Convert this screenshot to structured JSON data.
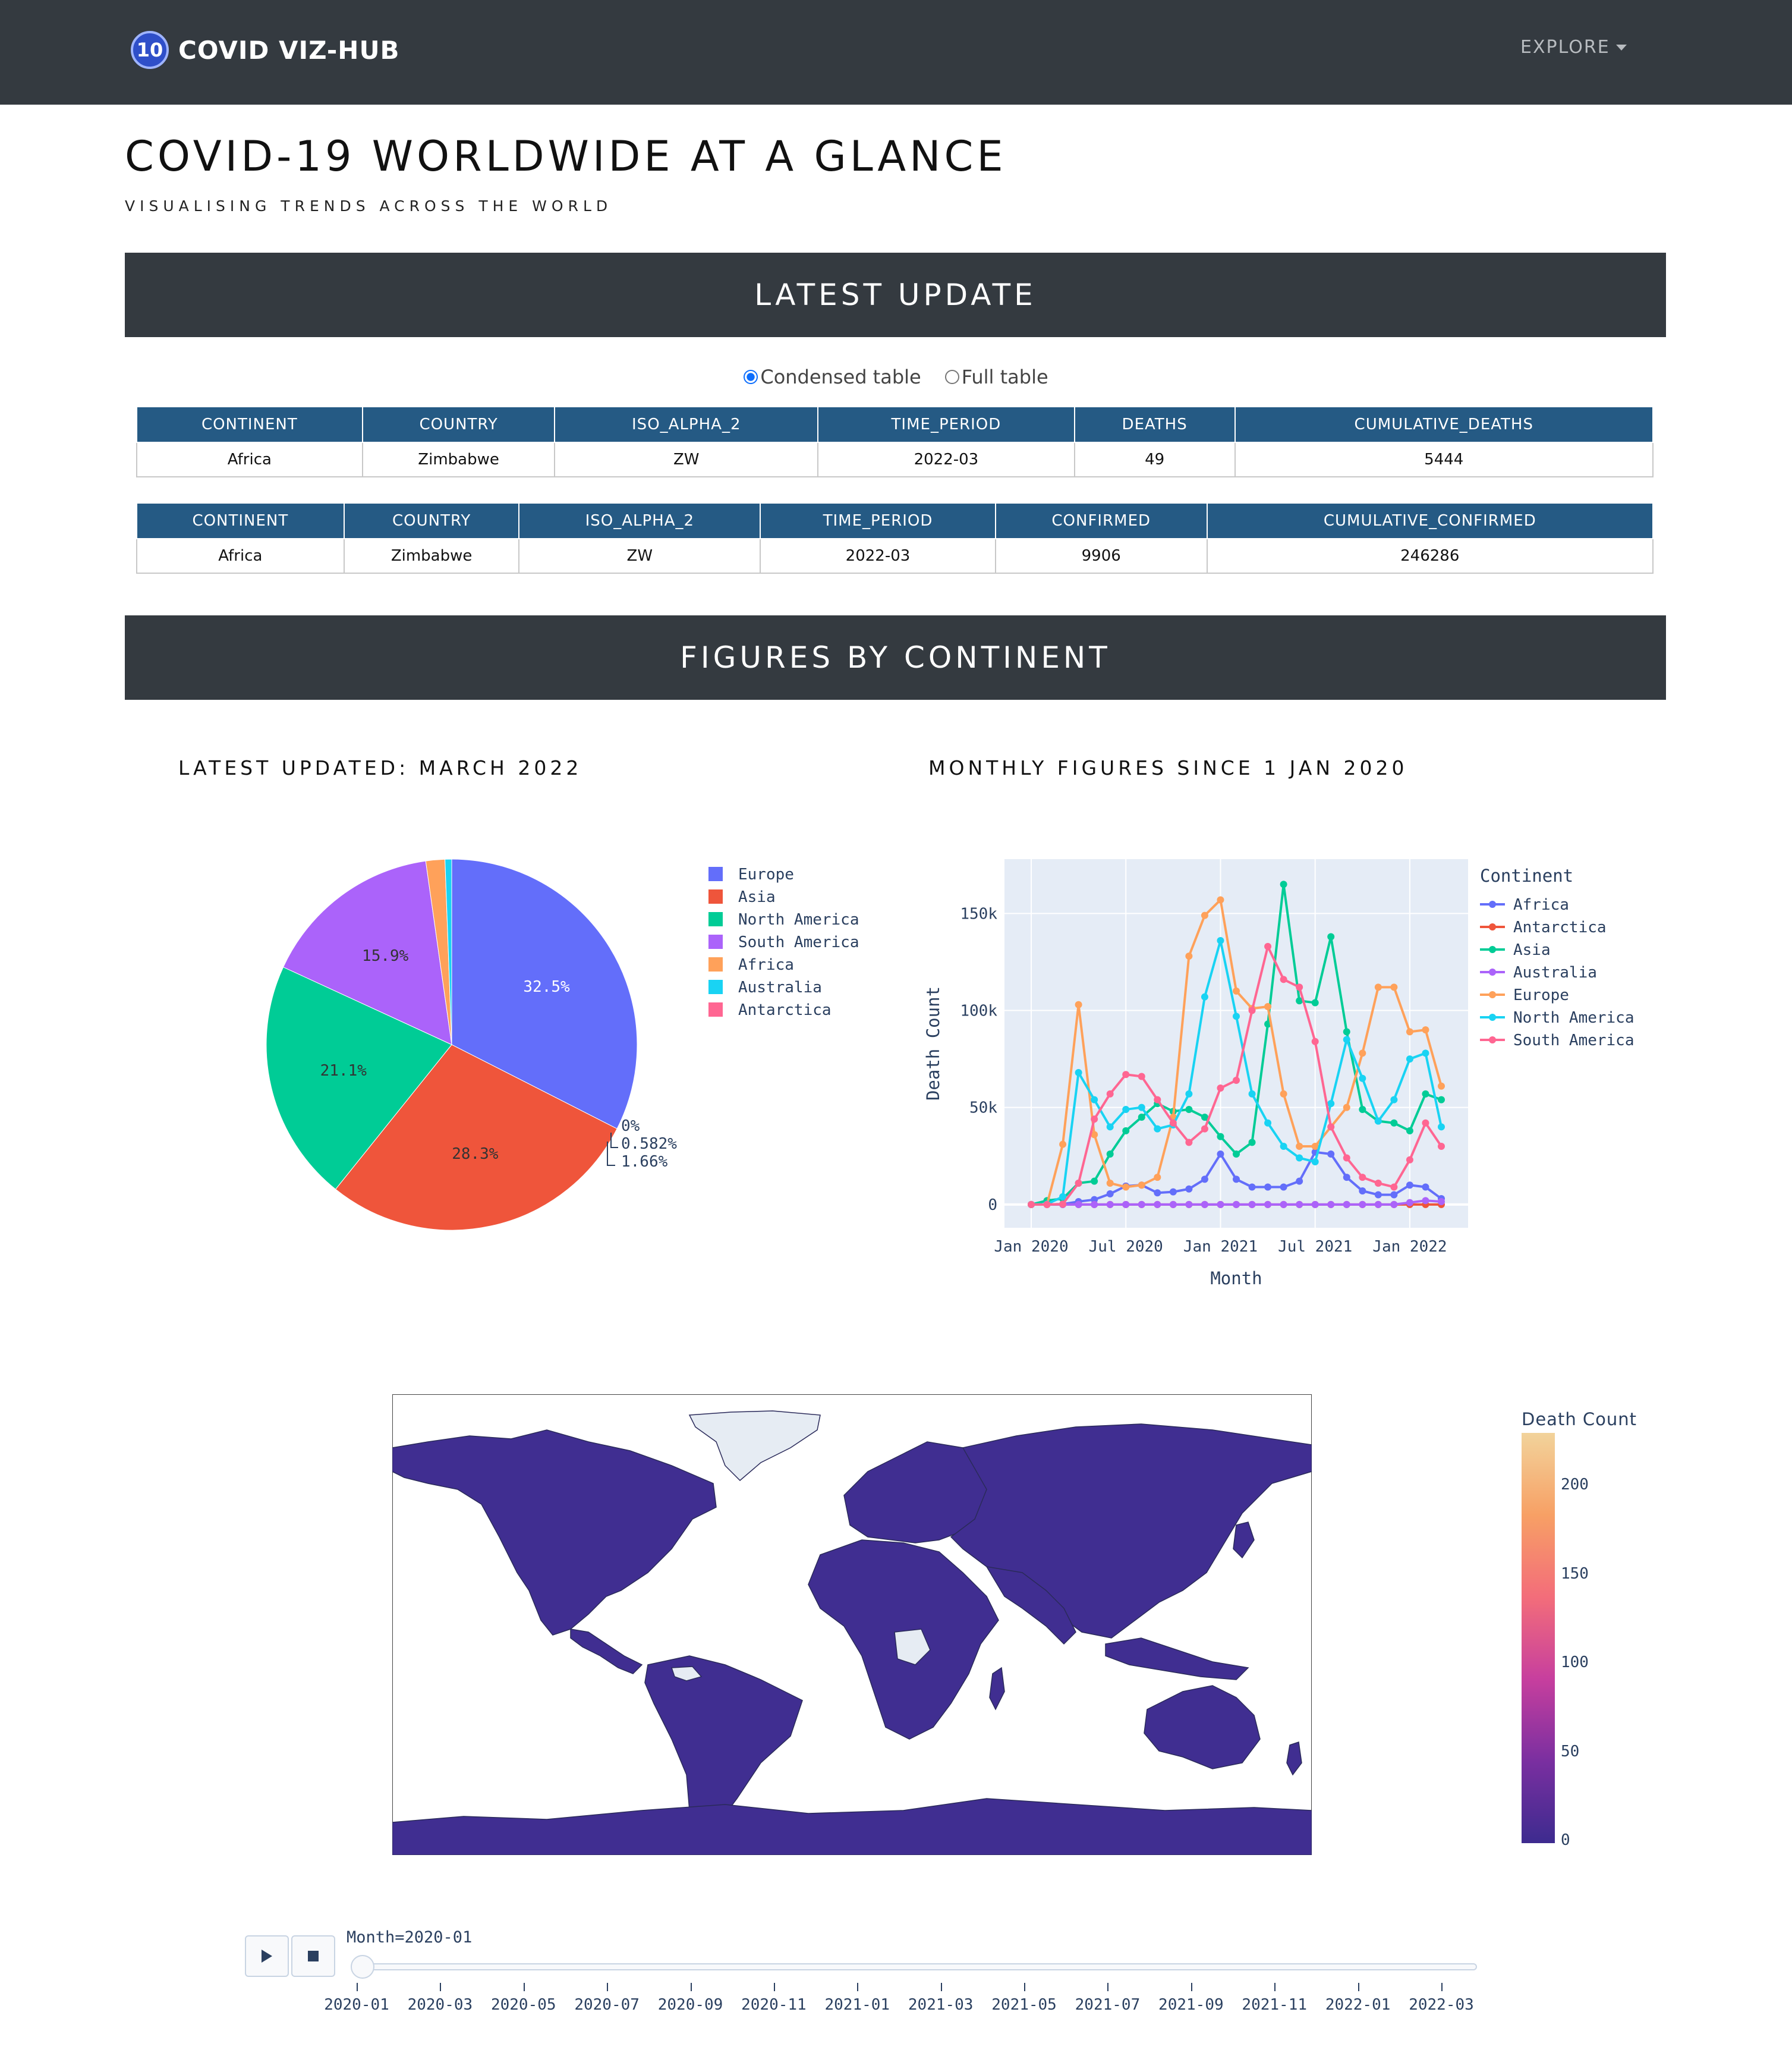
{
  "navbar": {
    "logo_text": "10",
    "brand": "COVID VIZ-HUB",
    "explore": "EXPLORE"
  },
  "header": {
    "title": "COVID-19 WORLDWIDE AT A GLANCE",
    "subtitle": "VISUALISING TRENDS ACROSS THE WORLD"
  },
  "latest_update": {
    "banner": "LATEST UPDATE",
    "radio_condensed": "Condensed table",
    "radio_full": "Full table",
    "deaths_table": {
      "headers": [
        "CONTINENT",
        "COUNTRY",
        "ISO_ALPHA_2",
        "TIME_PERIOD",
        "DEATHS",
        "CUMULATIVE_DEATHS"
      ],
      "row": [
        "Africa",
        "Zimbabwe",
        "ZW",
        "2022-03",
        "49",
        "5444"
      ]
    },
    "confirmed_table": {
      "headers": [
        "CONTINENT",
        "COUNTRY",
        "ISO_ALPHA_2",
        "TIME_PERIOD",
        "CONFIRMED",
        "CUMULATIVE_CONFIRMED"
      ],
      "row": [
        "Africa",
        "Zimbabwe",
        "ZW",
        "2022-03",
        "9906",
        "246286"
      ]
    }
  },
  "figures": {
    "banner": "FIGURES BY CONTINENT",
    "pie_title": "LATEST UPDATED: MARCH 2022",
    "line_title": "MONTHLY FIGURES SINCE 1 JAN 2020"
  },
  "chart_data": [
    {
      "type": "pie",
      "labels": [
        "Europe",
        "Asia",
        "North America",
        "South America",
        "Africa",
        "Australia",
        "Antarctica"
      ],
      "values": [
        32.5,
        28.3,
        21.1,
        15.9,
        1.66,
        0.582,
        0
      ],
      "value_labels": [
        "32.5%",
        "28.3%",
        "21.1%",
        "15.9%",
        "1.66%",
        "0.582%",
        "0%"
      ],
      "colors": [
        "#636efa",
        "#ef553b",
        "#00cc96",
        "#ab63fa",
        "#ffa15a",
        "#19d3f3",
        "#ff6692"
      ],
      "legend": "right"
    },
    {
      "type": "line",
      "xlabel": "Month",
      "ylabel": "Death Count",
      "legend_title": "Continent",
      "x_ticks": [
        "Jan 2020",
        "Jul 2020",
        "Jan 2021",
        "Jul 2021",
        "Jan 2022"
      ],
      "y_ticks": [
        "0",
        "50k",
        "100k",
        "150k"
      ],
      "ylim": [
        -12000,
        178000
      ],
      "x": [
        "2020-01",
        "2020-02",
        "2020-03",
        "2020-04",
        "2020-05",
        "2020-06",
        "2020-07",
        "2020-08",
        "2020-09",
        "2020-10",
        "2020-11",
        "2020-12",
        "2021-01",
        "2021-02",
        "2021-03",
        "2021-04",
        "2021-05",
        "2021-06",
        "2021-07",
        "2021-08",
        "2021-09",
        "2021-10",
        "2021-11",
        "2021-12",
        "2022-01",
        "2022-02",
        "2022-03"
      ],
      "series": [
        {
          "name": "Africa",
          "color": "#636efa",
          "values": [
            0,
            0,
            200,
            1500,
            2500,
            5500,
            9500,
            10000,
            6000,
            6500,
            8000,
            13000,
            26000,
            13000,
            9000,
            9000,
            9000,
            12000,
            27000,
            26000,
            14000,
            7000,
            5000,
            5000,
            10000,
            9000,
            3000
          ]
        },
        {
          "name": "Antarctica",
          "color": "#ef553b",
          "values": [
            0,
            0,
            0,
            0,
            0,
            0,
            0,
            0,
            0,
            0,
            0,
            0,
            0,
            0,
            0,
            0,
            0,
            0,
            0,
            0,
            0,
            0,
            0,
            0,
            0,
            0,
            0
          ]
        },
        {
          "name": "Asia",
          "color": "#00cc96",
          "values": [
            0,
            2000,
            3000,
            11000,
            12000,
            26000,
            38000,
            45000,
            52000,
            48000,
            49000,
            45000,
            35000,
            26000,
            32000,
            93000,
            165000,
            105000,
            104000,
            138000,
            89000,
            49000,
            43000,
            42000,
            38000,
            57000,
            54000
          ]
        },
        {
          "name": "Australia",
          "color": "#ab63fa",
          "values": [
            0,
            0,
            0,
            0,
            0,
            0,
            0,
            0,
            0,
            0,
            0,
            0,
            0,
            0,
            0,
            0,
            0,
            0,
            0,
            0,
            0,
            0,
            0,
            0,
            1000,
            2000,
            1500
          ]
        },
        {
          "name": "Europe",
          "color": "#ffa15a",
          "values": [
            0,
            0,
            31000,
            103000,
            36000,
            11000,
            9000,
            10000,
            14000,
            45000,
            128000,
            149000,
            157000,
            110000,
            101000,
            102000,
            57000,
            30000,
            30000,
            40000,
            50000,
            78000,
            112000,
            112000,
            89000,
            90000,
            61000
          ]
        },
        {
          "name": "North America",
          "color": "#19d3f3",
          "values": [
            0,
            200,
            4000,
            68000,
            54000,
            40000,
            49000,
            50000,
            39000,
            41000,
            57000,
            107000,
            136000,
            97000,
            57000,
            42000,
            30000,
            24000,
            22000,
            52000,
            85000,
            65000,
            43000,
            54000,
            75000,
            78000,
            40000
          ]
        },
        {
          "name": "South America",
          "color": "#ff6692",
          "values": [
            0,
            0,
            200,
            11000,
            44000,
            57000,
            67000,
            66000,
            54000,
            42000,
            32000,
            39000,
            60000,
            64000,
            100000,
            133000,
            116000,
            112000,
            84000,
            40000,
            24000,
            14000,
            11000,
            9000,
            23000,
            42000,
            30000
          ]
        }
      ]
    },
    {
      "type": "heatmap",
      "subtype": "choropleth-world-map",
      "colorbar_title": "Death Count",
      "colorbar_ticks": [
        "0",
        "50",
        "100",
        "150",
        "200"
      ],
      "colorscale": [
        "#3d2b8f",
        "#7a2fa0",
        "#c73f9e",
        "#f36d7a",
        "#f7a065",
        "#f2d39b"
      ],
      "frame": "2020-01",
      "default_land_color": "#402e91",
      "no_data_color": "#e6ecf3"
    }
  ],
  "slider": {
    "current_label": "Month=2020-01",
    "play_icon": "play-icon",
    "stop_icon": "stop-icon",
    "ticks": [
      "2020-01",
      "2020-03",
      "2020-05",
      "2020-07",
      "2020-09",
      "2020-11",
      "2021-01",
      "2021-03",
      "2021-05",
      "2021-07",
      "2021-09",
      "2021-11",
      "2022-01",
      "2022-03"
    ],
    "position_fraction": 0
  }
}
